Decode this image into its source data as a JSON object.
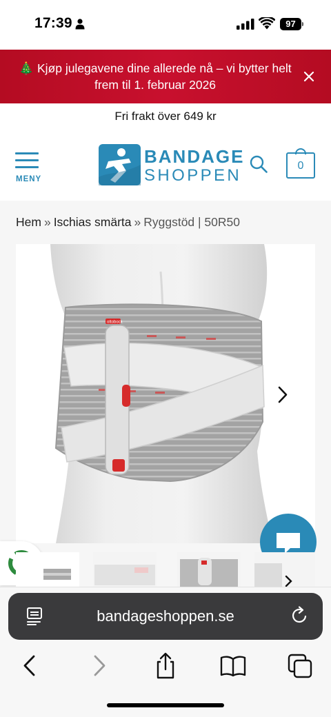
{
  "status_bar": {
    "time": "17:39",
    "battery": "97"
  },
  "promo": {
    "emoji": "🎄",
    "text": "Kjøp julegavene dine allerede nå – vi bytter helt frem til 1. februar 2026"
  },
  "shipping_notice": "Fri frakt över 649 kr",
  "header": {
    "menu_label": "MENY",
    "logo_line1": "BANDAGE",
    "logo_line2": "SHOPPEN",
    "cart_count": "0"
  },
  "breadcrumb": {
    "items": [
      "Hem",
      "Ischias smärta",
      "Ryggstöd | 50R50"
    ],
    "separator": "»"
  },
  "product": {
    "brand_tag": "ottobock"
  },
  "browser": {
    "url": "bandageshoppen.se"
  },
  "colors": {
    "accent": "#2a8ab7",
    "promo_bg": "#c8102e",
    "chat_bg": "#2a8ab7"
  },
  "icons": {
    "person": "person-icon",
    "signal": "signal-icon",
    "wifi": "wifi-icon",
    "close": "close-icon",
    "search": "search-icon",
    "cart": "shopping-bag-icon",
    "chat": "chat-icon",
    "recycle": "recycle-icon",
    "next": "chevron-right-icon",
    "reload": "reload-icon",
    "back": "back-icon",
    "forward": "forward-icon",
    "share": "share-icon",
    "bookmarks": "book-icon",
    "tabs": "tabs-icon"
  }
}
